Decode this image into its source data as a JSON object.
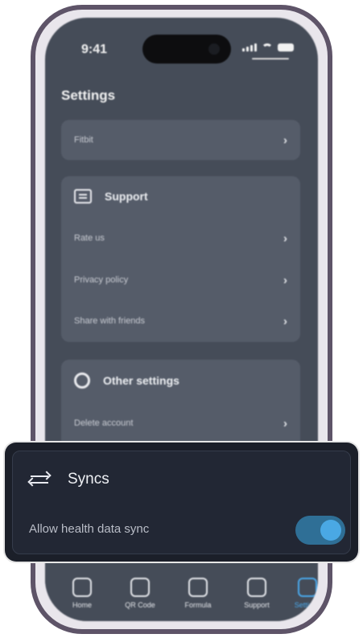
{
  "status_bar": {
    "time": "9:41"
  },
  "settings": {
    "title": "Settings",
    "account_card": {
      "items": [
        {
          "label": "Fitbit"
        }
      ]
    },
    "support": {
      "title": "Support",
      "icon": "chat-bubble-icon",
      "items": [
        {
          "label": "Rate us"
        },
        {
          "label": "Privacy policy"
        },
        {
          "label": "Share with friends"
        }
      ]
    },
    "other": {
      "title": "Other settings",
      "icon": "gear-icon",
      "items": [
        {
          "label": "Delete account"
        }
      ]
    }
  },
  "tabbar": {
    "tabs": [
      {
        "label": "Home",
        "icon": "home-icon",
        "active": false
      },
      {
        "label": "QR Code",
        "icon": "qr-code-icon",
        "active": false
      },
      {
        "label": "Formula",
        "icon": "formula-icon",
        "active": false
      },
      {
        "label": "Support",
        "icon": "support-icon",
        "active": false
      },
      {
        "label": "Settings",
        "icon": "settings-sliders-icon",
        "active": true
      }
    ],
    "active_color": "#4aa8ea"
  },
  "syncs": {
    "title": "Syncs",
    "icon": "swap-arrows-icon",
    "allow_label": "Allow health data sync",
    "allow_enabled": true,
    "accent_color": "#4aa8e4"
  }
}
